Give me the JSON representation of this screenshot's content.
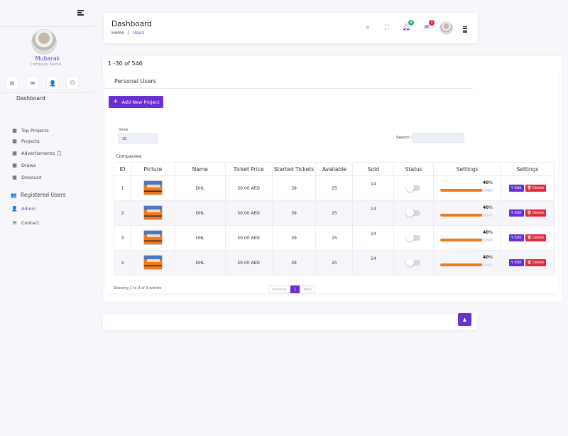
{
  "sidebar": {
    "user_name": "Mubarak",
    "company": "Company Name",
    "dashboard_label": "Dashboard",
    "items": [
      {
        "label": "Top Projects",
        "icon": "building-icon"
      },
      {
        "label": "Projects",
        "icon": "building-icon"
      },
      {
        "label": "Advertisments 📋",
        "icon": "building-icon"
      },
      {
        "label": "Draws",
        "icon": "building-icon"
      },
      {
        "label": "Discount",
        "icon": "building-icon"
      }
    ],
    "registered_users": "Registered Users",
    "admin": "Admin",
    "contact": "Contact"
  },
  "header": {
    "title": "Dashboard",
    "crumb_home": "Home",
    "crumb_sep": "/",
    "crumb_current": "Users",
    "notif_count": "4",
    "mail_count": "3"
  },
  "main": {
    "range": "1 -30 of 546",
    "card_title": "Personal Users",
    "add_button": "Add New Project",
    "show_label": "Show",
    "show_value": "10",
    "search_label": "Search :",
    "companies_label": "Companies",
    "columns": [
      "ID",
      "Picture",
      "Name",
      "Ticket Price",
      "Started Tickets",
      "Available",
      "Sold",
      "Status",
      "Settings",
      "Settings"
    ],
    "rows": [
      {
        "id": "1",
        "name": "DHL",
        "price": "50.00 AED",
        "started": "39",
        "available": "25",
        "sold": "14",
        "percent": "40",
        "progress": 0.8
      },
      {
        "id": "2",
        "name": "DHL",
        "price": "50.00 AED",
        "started": "39",
        "available": "25",
        "sold": "14",
        "percent": "40",
        "progress": 0.8
      },
      {
        "id": "3",
        "name": "DHL",
        "price": "50.00 AED",
        "started": "39",
        "available": "25",
        "sold": "14",
        "percent": "40",
        "progress": 0.8
      },
      {
        "id": "4",
        "name": "DHL",
        "price": "50.00 AED",
        "started": "39",
        "available": "25",
        "sold": "14",
        "percent": "40",
        "progress": 0.8
      }
    ],
    "percent_sign": "%",
    "edit_label": "Edit",
    "delete_label": "Delete",
    "entries": "Showing 1 to 3 of 3 entries",
    "prev": "Previous",
    "page": "1",
    "next": "Next"
  },
  "colors": {
    "accent": "#6a2fd3",
    "danger": "#e02a3e",
    "progress": "#f07a1a"
  }
}
